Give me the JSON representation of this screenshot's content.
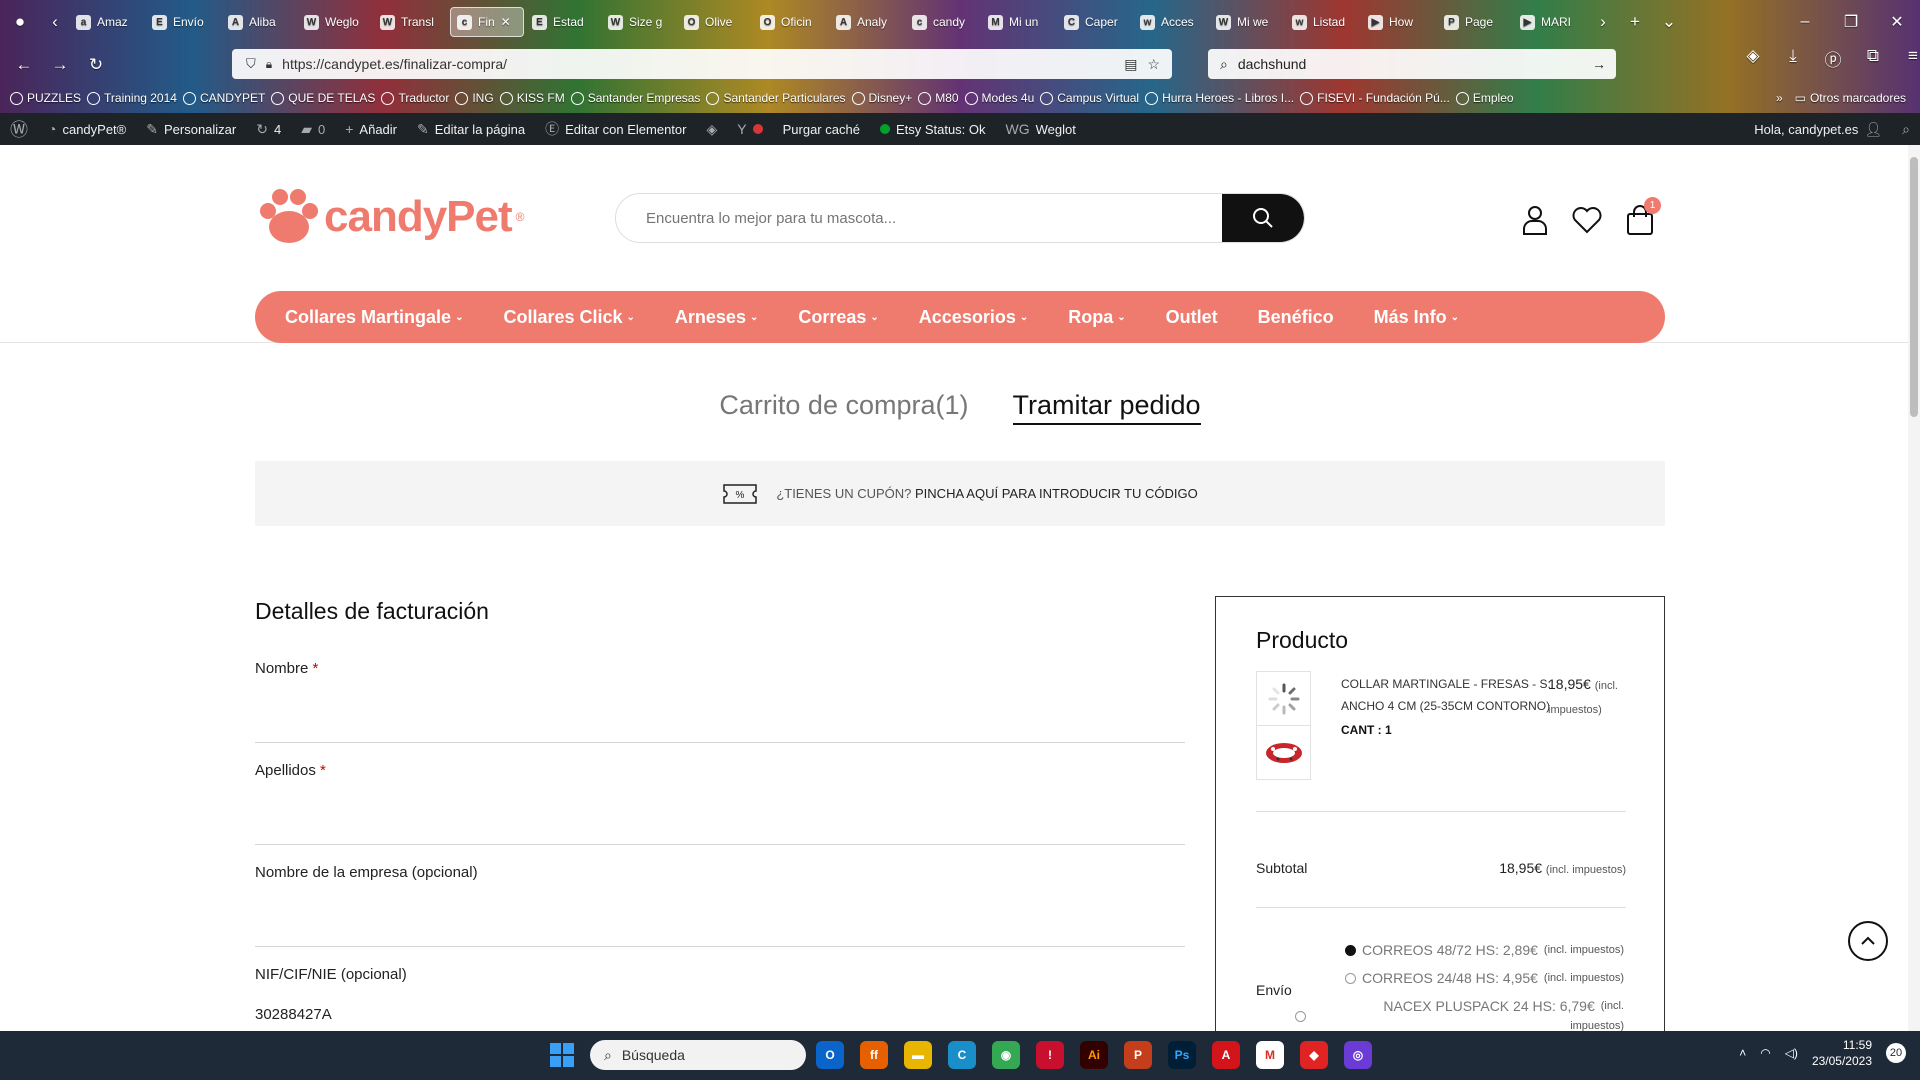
{
  "browser": {
    "tabs": [
      {
        "label": "Amaz",
        "fav": "a"
      },
      {
        "label": "Envío",
        "fav": "E"
      },
      {
        "label": "Aliba",
        "fav": "A"
      },
      {
        "label": "Weglo",
        "fav": "W"
      },
      {
        "label": "Transl",
        "fav": "W"
      },
      {
        "label": "Fin",
        "fav": "c",
        "active": true
      },
      {
        "label": "Estad",
        "fav": "E"
      },
      {
        "label": "Size g",
        "fav": "W"
      },
      {
        "label": "Olive",
        "fav": "O"
      },
      {
        "label": "Oficin",
        "fav": "O"
      },
      {
        "label": "Analy",
        "fav": "A"
      },
      {
        "label": "candy",
        "fav": "c"
      },
      {
        "label": "Mi un",
        "fav": "M"
      },
      {
        "label": "Caper",
        "fav": "C"
      },
      {
        "label": "Acces",
        "fav": "w"
      },
      {
        "label": "Mi we",
        "fav": "W"
      },
      {
        "label": "Listad",
        "fav": "w"
      },
      {
        "label": "How",
        "fav": "▶"
      },
      {
        "label": "Page",
        "fav": "P"
      },
      {
        "label": "MARI",
        "fav": "▶"
      }
    ],
    "url": "https://candypet.es/finalizar-compra/",
    "search_query": "dachshund",
    "bookmarks": [
      "PUZZLES",
      "Training 2014",
      "CANDYPET",
      "QUE DE TELAS",
      "Traductor",
      "ING",
      "KISS FM",
      "Santander Empresas",
      "Santander Particulares",
      "Disney+",
      "M80",
      "Modes 4u",
      "Campus Virtual",
      "Hurra Heroes - Libros I...",
      "FISEVI - Fundación Pú...",
      "Empleo"
    ],
    "bookmarks_overflow": "Otros marcadores"
  },
  "adminbar": {
    "site": "candyPet®",
    "customize": "Personalizar",
    "updates": "4",
    "comments": "0",
    "add": "Añadir",
    "edit_page": "Editar la página",
    "edit_elementor": "Editar con Elementor",
    "purge": "Purgar caché",
    "etsy": "Etsy Status: Ok",
    "weglot": "Weglot",
    "greeting": "Hola, candypet.es"
  },
  "header": {
    "logo_text": "candyPet",
    "logo_reg": "®",
    "search_placeholder": "Encuentra lo mejor para tu mascota...",
    "cart_count": "1",
    "nav": [
      {
        "label": "Collares Martingale",
        "caret": true
      },
      {
        "label": "Collares Click",
        "caret": true
      },
      {
        "label": "Arneses",
        "caret": true
      },
      {
        "label": "Correas",
        "caret": true
      },
      {
        "label": "Accesorios",
        "caret": true
      },
      {
        "label": "Ropa",
        "caret": true
      },
      {
        "label": "Outlet",
        "caret": false
      },
      {
        "label": "Benéfico",
        "caret": false
      },
      {
        "label": "Más Info",
        "caret": true
      }
    ]
  },
  "checkout": {
    "step_cart": "Carrito de compra(1)",
    "step_checkout": "Tramitar pedido",
    "coupon_question": "¿TIENES UN CUPÓN?",
    "coupon_link": "PINCHA AQUÍ PARA INTRODUCIR TU CÓDIGO",
    "billing_title": "Detalles de facturación",
    "fields": [
      {
        "label": "Nombre",
        "required": "*",
        "value": ""
      },
      {
        "label": "Apellidos",
        "required": "*",
        "value": ""
      },
      {
        "label": "Nombre de la empresa (opcional)",
        "required": "",
        "value": ""
      },
      {
        "label": "NIF/CIF/NIE (opcional)",
        "required": "",
        "value": "30288427A"
      }
    ]
  },
  "order": {
    "title": "Producto",
    "product_name": "COLLAR MARTINGALE - FRESAS - S: ANCHO 4 CM (25-35CM CONTORNO)",
    "product_price": "18,95€",
    "tax_note": "(incl. impuestos)",
    "qty_label": "CANT : 1",
    "subtotal_label": "Subtotal",
    "subtotal_value": "18,95€",
    "shipping_label": "Envío",
    "shipping_options": [
      {
        "label": "CORREOS 48/72 HS: 2,89€",
        "note": "(incl. impuestos)",
        "selected": true
      },
      {
        "label": "CORREOS 24/48 HS: 4,95€",
        "note": "(incl. impuestos)",
        "selected": false
      },
      {
        "label": "NACEX PLUSPACK 24 HS: 6,79€",
        "note": "(incl.",
        "selected": false
      }
    ],
    "shipping_overflow": "impuestos)"
  },
  "taskbar": {
    "search_placeholder": "Búsqueda",
    "time": "11:59",
    "date": "23/05/2023",
    "notifications": "20"
  },
  "colors": {
    "brand": "#ef7b6e",
    "admin_bg": "#1d2327",
    "taskbar_bg": "#1f2a38"
  }
}
